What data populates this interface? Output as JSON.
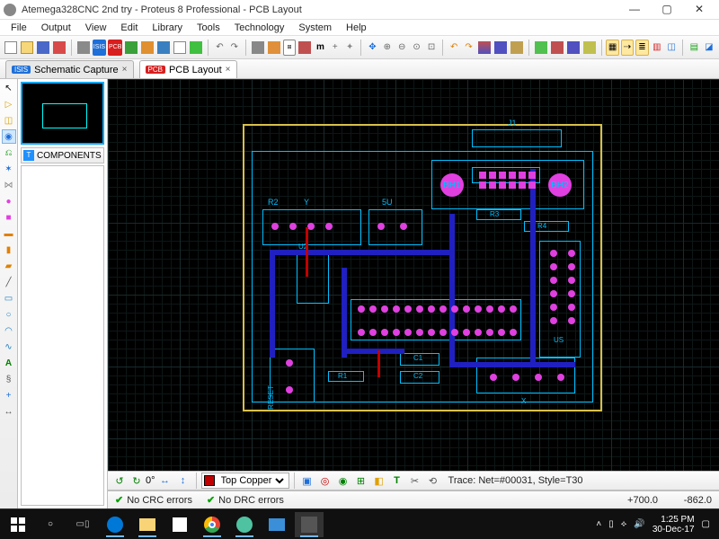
{
  "titlebar": {
    "title": "Atemega328CNC 2nd try - Proteus 8 Professional - PCB Layout"
  },
  "menu": [
    "File",
    "Output",
    "View",
    "Edit",
    "Library",
    "Tools",
    "Technology",
    "System",
    "Help"
  ],
  "tabs": [
    {
      "label": "Schematic Capture",
      "badge": "ISIS",
      "badgeColor": "#1e6fd8",
      "active": false
    },
    {
      "label": "PCB Layout",
      "badge": "PCB",
      "badgeColor": "#d81e1e",
      "active": true
    }
  ],
  "components": {
    "header": "COMPONENTS",
    "badge": "T"
  },
  "layer": {
    "selected": "Top Copper"
  },
  "trace_info": "Trace: Net=#00031, Style=T30",
  "rotation": "0°",
  "status": {
    "crc": "No CRC errors",
    "drc": "No DRC errors",
    "coord_x": "+700.0",
    "coord_y": "-862.0"
  },
  "designators": {
    "bh1": "BH1",
    "bh2": "BH2",
    "j1": "J1",
    "r3": "R3",
    "r4": "R4",
    "r2": "R2",
    "us": "US",
    "c1": "C1",
    "c2": "C2",
    "r1": "R1",
    "u2": "U2",
    "x": "X",
    "y": "Y",
    "reset": "RESET",
    "5u": "5U"
  },
  "taskbar": {
    "tray": {
      "time": "1:25 PM",
      "date": "30-Dec-17"
    }
  }
}
